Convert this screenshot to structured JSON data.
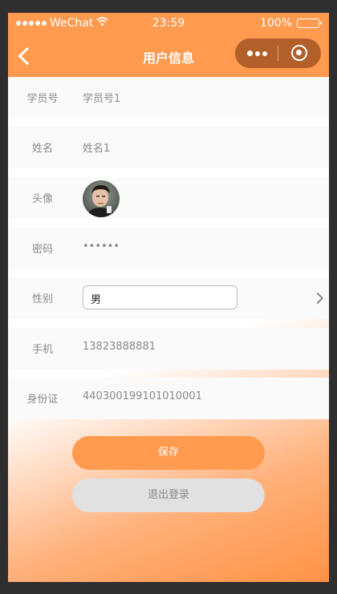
{
  "status_bar": {
    "carrier": "WeChat",
    "time": "23:59",
    "battery": "100%",
    "wifi_icon": "wifi-icon",
    "battery_icon": "battery-icon"
  },
  "nav": {
    "title": "用户信息",
    "back_icon": "back-chevron-icon",
    "more_icon": "more-dots-icon",
    "close_icon": "target-close-icon",
    "bar_color": "#ff9a4f",
    "capsule_color": "#b25f2a"
  },
  "form": {
    "student_id": {
      "label": "学员号",
      "value": "学员号1"
    },
    "name": {
      "label": "姓名",
      "value": "姓名1"
    },
    "avatar": {
      "label": "头像"
    },
    "password": {
      "label": "密码",
      "value": "••••••"
    },
    "gender": {
      "label": "性别",
      "value": "男"
    },
    "phone": {
      "label": "手机",
      "value": "13823888881"
    },
    "id_card": {
      "label": "身份证",
      "value": "440300199101010001"
    }
  },
  "buttons": {
    "save": "保存",
    "logout": "退出登录"
  },
  "colors": {
    "accent": "#ff9a4f",
    "row_bg": "#fafafa",
    "label_text": "#8a8a8a"
  }
}
